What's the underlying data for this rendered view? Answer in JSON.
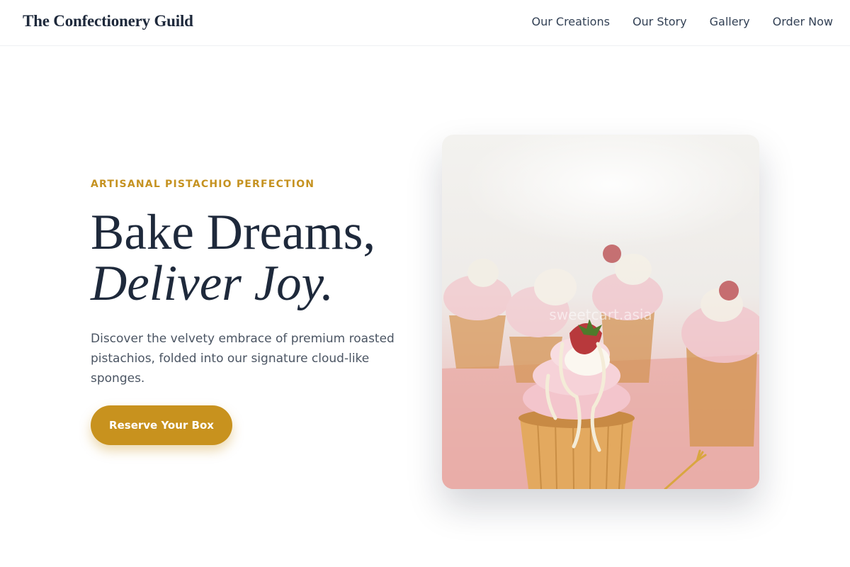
{
  "header": {
    "brand": "The Confectionery Guild",
    "nav": [
      "Our Creations",
      "Our Story",
      "Gallery",
      "Order Now"
    ]
  },
  "hero": {
    "eyebrow": "ARTISANAL PISTACHIO PERFECTION",
    "headline_line1": "Bake Dreams,",
    "headline_line2": "Deliver Joy.",
    "description": "Discover the velvety embrace of premium roasted pistachios, folded into our signature cloud-like sponges.",
    "cta_label": "Reserve Your Box"
  },
  "image": {
    "watermark": "sweetcart.asia"
  },
  "colors": {
    "accent": "#c8921e",
    "heading": "#1e293b",
    "body_text": "#4b5563"
  }
}
